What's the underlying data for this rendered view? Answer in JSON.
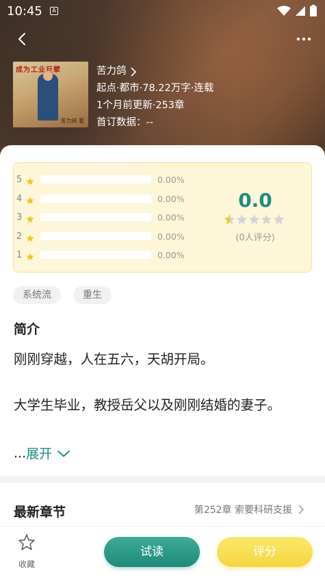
{
  "status_bar": {
    "time": "10:45",
    "app_icon": "A"
  },
  "nav": {
    "back_icon": "chevron-left-icon",
    "more_icon": "more-dots-icon"
  },
  "book": {
    "cover_title": "成为工业巨擘",
    "cover_author": "苦力鸽 著",
    "author": "苦力鸽",
    "meta_line": "起点·都市·78.22万字·连载",
    "update_line": "1个月前更新·253章",
    "first_sub_line": "首订数据：--"
  },
  "ratings": {
    "rows": [
      {
        "stars": "5",
        "pct": "0.00%"
      },
      {
        "stars": "4",
        "pct": "0.00%"
      },
      {
        "stars": "3",
        "pct": "0.00%"
      },
      {
        "stars": "2",
        "pct": "0.00%"
      },
      {
        "stars": "1",
        "pct": "0.00%"
      }
    ],
    "score": "0.0",
    "score_stars_filled": 0.5,
    "count": "(0人评分)"
  },
  "tags": [
    "系统流",
    "重生"
  ],
  "intro": {
    "title": "简介",
    "para1": "刚刚穿越，人在五六，天胡开局。",
    "para2": "大学生毕业，教授岳父以及刚刚结婚的妻子。",
    "ellipsis": "...",
    "expand_label": "展开"
  },
  "latest": {
    "title": "最新章节",
    "chapter": "第252章 索要科研支援"
  },
  "bottom": {
    "fav_label": "收藏",
    "read_label": "试读",
    "rate_label": "评分"
  },
  "colors": {
    "accent": "#1f8c80",
    "star": "#f5c518",
    "rate_button": "#f5d640"
  }
}
